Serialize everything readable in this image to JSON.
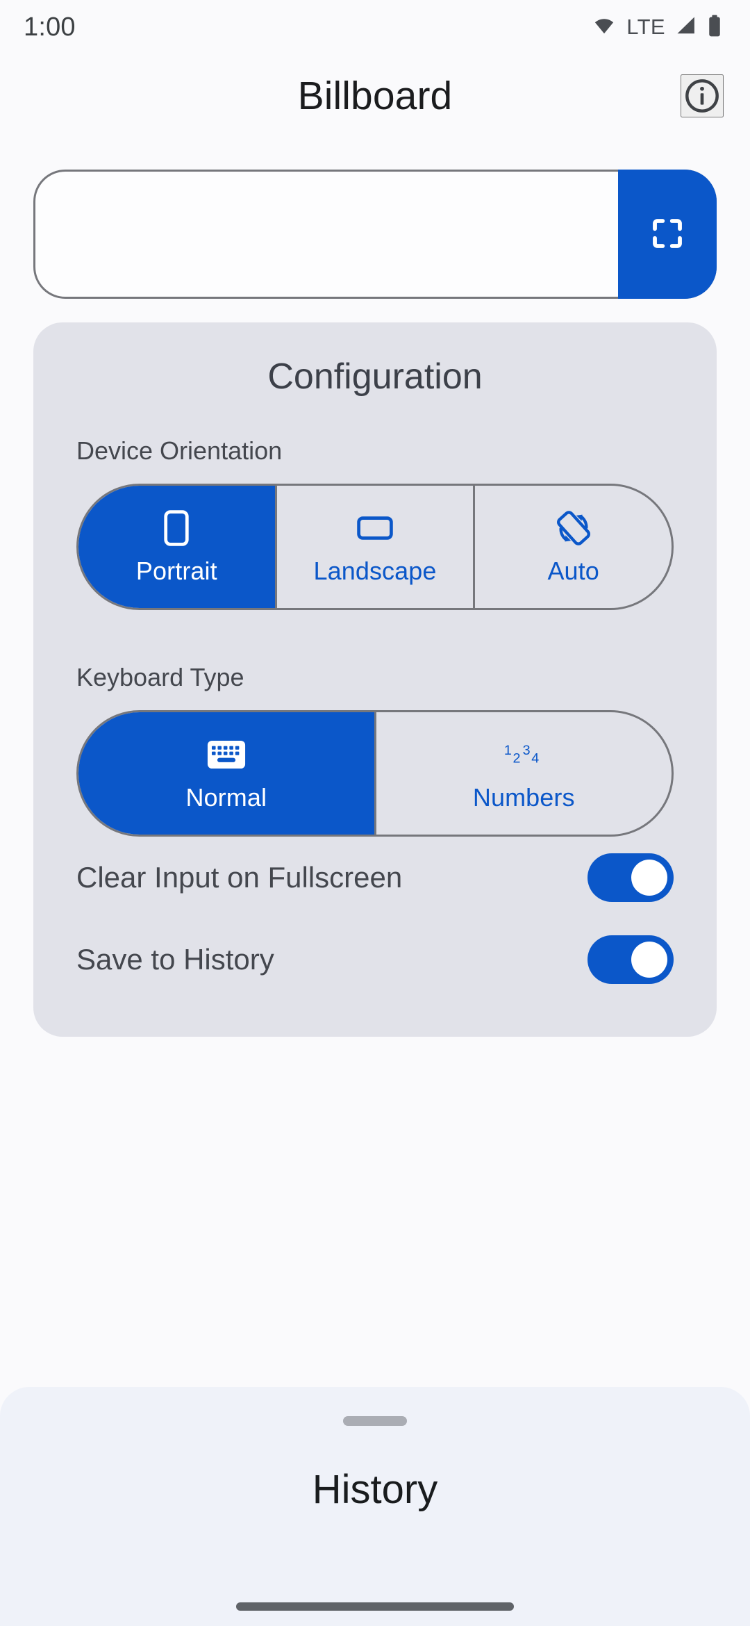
{
  "status_bar": {
    "time": "1:00",
    "network_label": "LTE",
    "icons": [
      "wifi-icon",
      "signal-icon",
      "battery-icon"
    ]
  },
  "app_bar": {
    "title": "Billboard",
    "info_icon": "info-icon"
  },
  "input": {
    "value": "",
    "placeholder": "",
    "fullscreen_icon": "fullscreen-icon"
  },
  "config": {
    "title": "Configuration",
    "orientation": {
      "label": "Device Orientation",
      "selected": "Portrait",
      "options": [
        {
          "label": "Portrait",
          "icon": "phone-portrait-icon",
          "selected": true
        },
        {
          "label": "Landscape",
          "icon": "phone-landscape-icon",
          "selected": false
        },
        {
          "label": "Auto",
          "icon": "screen-rotation-icon",
          "selected": false
        }
      ]
    },
    "keyboard": {
      "label": "Keyboard Type",
      "selected": "Normal",
      "options": [
        {
          "label": "Normal",
          "icon": "keyboard-icon",
          "selected": true
        },
        {
          "label": "Numbers",
          "icon": "numbers-123-icon",
          "icon_text": "1234",
          "selected": false
        }
      ]
    },
    "switches": [
      {
        "label": "Clear Input on Fullscreen",
        "on": true
      },
      {
        "label": "Save to History",
        "on": true
      }
    ]
  },
  "bottom_sheet": {
    "title": "History",
    "handle": "drag-handle"
  },
  "colors": {
    "accent": "#0B57C9",
    "card_bg": "#E1E2E9",
    "sheet_bg": "#EFF2F9",
    "page_bg": "#FAFAFC",
    "outline": "#76777C",
    "text": "#44474E"
  }
}
